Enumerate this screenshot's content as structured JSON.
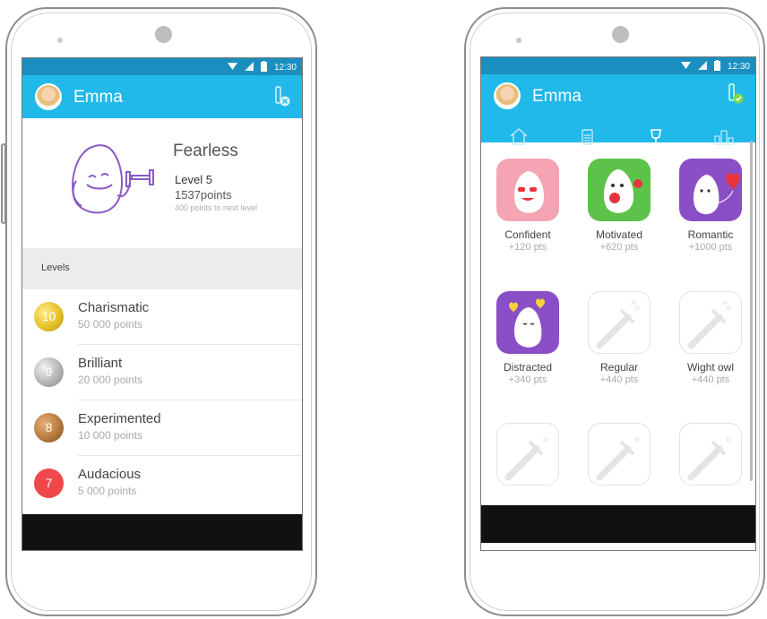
{
  "left_phone": {
    "status": {
      "time": "12:30"
    },
    "appbar": {
      "user_name": "Emma"
    },
    "profile": {
      "title": "Fearless",
      "level": "Level 5",
      "points": "1537points",
      "next_level": "400 points to next level"
    },
    "levels_header": "Levels",
    "levels": [
      {
        "number": "10",
        "name": "Charismatic",
        "points": "50 000 points",
        "color": "#e6c228"
      },
      {
        "number": "9",
        "name": "Brilliant",
        "points": "20 000 points",
        "color": "#b4b4b4"
      },
      {
        "number": "8",
        "name": "Experimented",
        "points": "10 000 points",
        "color": "#b57a3e"
      },
      {
        "number": "7",
        "name": "Audacious",
        "points": "5 000 points",
        "color": "#f0474b"
      }
    ]
  },
  "right_phone": {
    "status": {
      "time": "12:30"
    },
    "appbar": {
      "user_name": "Emma"
    },
    "tabs": [
      {
        "icon": "home-icon"
      },
      {
        "icon": "clipboard-icon"
      },
      {
        "icon": "trophy-icon"
      },
      {
        "icon": "bar-chart-icon"
      }
    ],
    "badges": [
      {
        "name": "Confident",
        "points": "+120 pts",
        "color": "#f5a4b4",
        "unlocked": true
      },
      {
        "name": "Motivated",
        "points": "+620 pts",
        "color": "#5cc24a",
        "unlocked": true
      },
      {
        "name": "Romantic",
        "points": "+1000 pts",
        "color": "#8a4fc6",
        "unlocked": true
      },
      {
        "name": "Distracted",
        "points": "+340 pts",
        "color": "#8a4fc6",
        "unlocked": true
      },
      {
        "name": "Regular",
        "points": "+440 pts",
        "unlocked": false
      },
      {
        "name": "Wight owl",
        "points": "+440 pts",
        "unlocked": false
      },
      {
        "name": "",
        "points": "",
        "unlocked": false
      },
      {
        "name": "",
        "points": "",
        "unlocked": false
      },
      {
        "name": "",
        "points": "",
        "unlocked": false
      }
    ]
  },
  "colors": {
    "appbar": "#21b8ea",
    "statusbar": "#1a8fbf",
    "navbar": "#111111"
  }
}
